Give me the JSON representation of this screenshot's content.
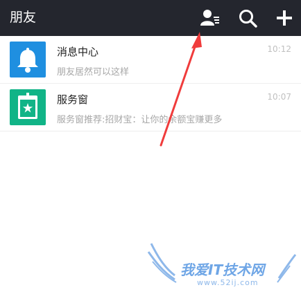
{
  "header": {
    "title": "朋友",
    "icons": {
      "contacts": "contacts-icon",
      "search": "search-icon",
      "add": "plus-icon"
    }
  },
  "conversations": [
    {
      "name": "消息中心",
      "preview": "朋友居然可以这样",
      "time": "10:12",
      "icon": "bell-icon",
      "color": "#1f8fe0"
    },
    {
      "name": "服务窗",
      "preview": "服务窗推荐:招财宝：让你的余额宝赚更多",
      "time": "10:07",
      "icon": "service-window-icon",
      "color": "#11b487"
    }
  ],
  "watermark": {
    "text": "我爱IT技术网",
    "url": "www.52ij.com"
  },
  "colors": {
    "header_bg": "#24262e",
    "annotation_arrow": "#f03c3c"
  }
}
